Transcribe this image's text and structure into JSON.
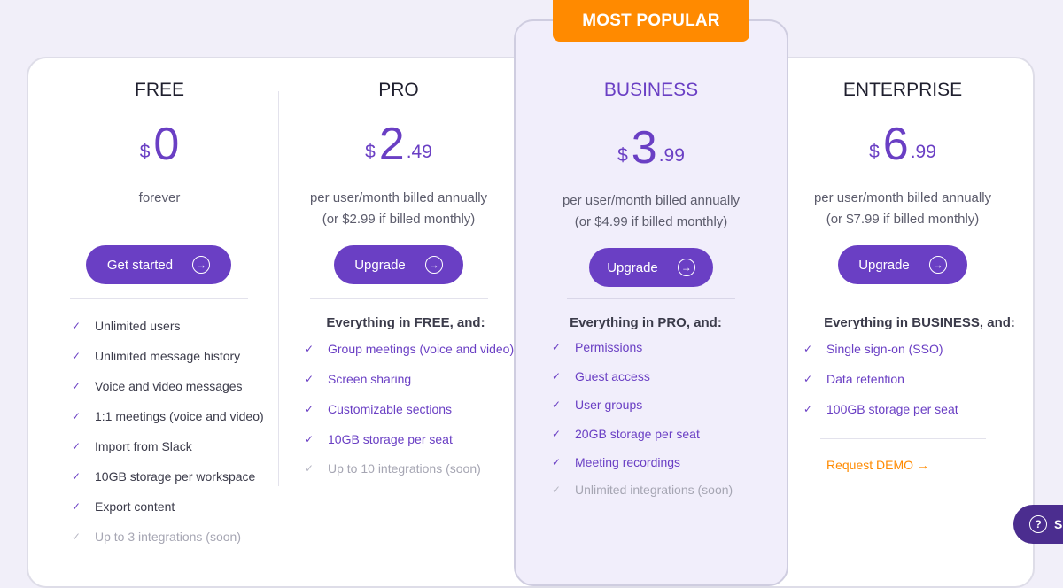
{
  "badge": "MOST POPULAR",
  "plans": [
    {
      "name": "FREE",
      "currency": "$",
      "price_int": "0",
      "price_dec": "",
      "billing_line1": "forever",
      "billing_line2": "",
      "button": "Get started",
      "heading": "",
      "features": [
        "Unlimited users",
        "Unlimited message history",
        "Voice and video messages",
        "1:1 meetings (voice and video)",
        "Import from Slack",
        "10GB storage per workspace",
        "Export content"
      ],
      "soon": "Up to 3 integrations (soon)"
    },
    {
      "name": "PRO",
      "currency": "$",
      "price_int": "2",
      "price_dec": ".49",
      "billing_line1": "per user/month billed annually",
      "billing_line2": "(or $2.99 if billed monthly)",
      "button": "Upgrade",
      "heading": "Everything in FREE, and:",
      "features": [
        "Group meetings (voice and video)",
        "Screen sharing",
        "Customizable sections",
        "10GB storage per seat"
      ],
      "soon": "Up to 10 integrations (soon)"
    },
    {
      "name": "BUSINESS",
      "currency": "$",
      "price_int": "3",
      "price_dec": ".99",
      "billing_line1": "per user/month billed annually",
      "billing_line2": "(or $4.99 if billed monthly)",
      "button": "Upgrade",
      "heading": "Everything in PRO, and:",
      "features": [
        "Permissions",
        "Guest access",
        "User groups",
        "20GB storage per seat",
        "Meeting recordings"
      ],
      "soon": "Unlimited integrations (soon)"
    },
    {
      "name": "ENTERPRISE",
      "currency": "$",
      "price_int": "6",
      "price_dec": ".99",
      "billing_line1": "per user/month billed annually",
      "billing_line2": "(or $7.99 if billed monthly)",
      "button": "Upgrade",
      "heading": "Everything in BUSINESS, and:",
      "features": [
        "Single sign-on (SSO)",
        "Data retention",
        "100GB storage per seat"
      ],
      "soon": ""
    }
  ],
  "request_demo": "Request DEMO →",
  "help": {
    "icon": "question-circle-icon",
    "label": "S"
  },
  "colors": {
    "accent": "#6a3fc4",
    "badge": "#ff8a00",
    "background": "#f1eff9"
  }
}
